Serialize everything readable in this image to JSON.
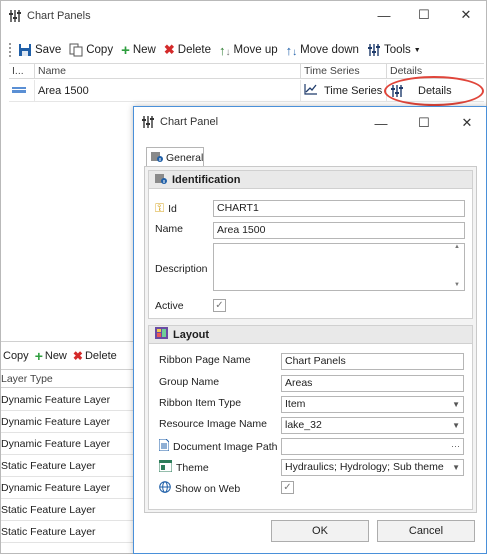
{
  "outer_window": {
    "title": "Chart Panels",
    "toolbar": {
      "save": "Save",
      "copy": "Copy",
      "new": "New",
      "delete": "Delete",
      "move_up": "Move up",
      "move_down": "Move down",
      "tools": "Tools"
    },
    "grid": {
      "headers": [
        "I...",
        "Name",
        "Time Series",
        "Details"
      ],
      "row": {
        "name": "Area 1500",
        "time_series": "Time Series",
        "details": "Details"
      }
    },
    "lower_toolbar": {
      "copy": "Copy",
      "new": "New",
      "delete": "Delete"
    },
    "layer_grid": {
      "header": "Layer Type",
      "rows": [
        "Dynamic Feature Layer",
        "Dynamic Feature Layer",
        "Dynamic Feature Layer",
        "Static Feature Layer",
        "Dynamic Feature Layer",
        "Static Feature Layer",
        "Static Feature Layer"
      ]
    }
  },
  "dialog": {
    "title": "Chart Panel",
    "tab": "General",
    "identification": {
      "header": "Identification",
      "id_label": "Id",
      "id_value": "CHART1",
      "name_label": "Name",
      "name_value": "Area 1500",
      "description_label": "Description",
      "description_value": "",
      "active_label": "Active",
      "active_checked": true
    },
    "layout": {
      "header": "Layout",
      "ribbon_page_name_label": "Ribbon Page Name",
      "ribbon_page_name_value": "Chart Panels",
      "group_name_label": "Group Name",
      "group_name_value": "Areas",
      "ribbon_item_type_label": "Ribbon Item Type",
      "ribbon_item_type_value": "Item",
      "resource_image_name_label": "Resource Image Name",
      "resource_image_name_value": "lake_32",
      "document_image_path_label": "Document Image Path",
      "document_image_path_value": "",
      "theme_label": "Theme",
      "theme_value": "Hydraulics; Hydrology; Sub theme",
      "show_on_web_label": "Show on Web",
      "show_on_web_checked": true
    },
    "ok": "OK",
    "cancel": "Cancel"
  },
  "colors": {
    "highlight_circle": "#e0453a",
    "dialog_border": "#4a90d9",
    "new_icon": "#2e9e3e",
    "delete_icon": "#d42a2a",
    "save_icon": "#1f5fa8"
  }
}
